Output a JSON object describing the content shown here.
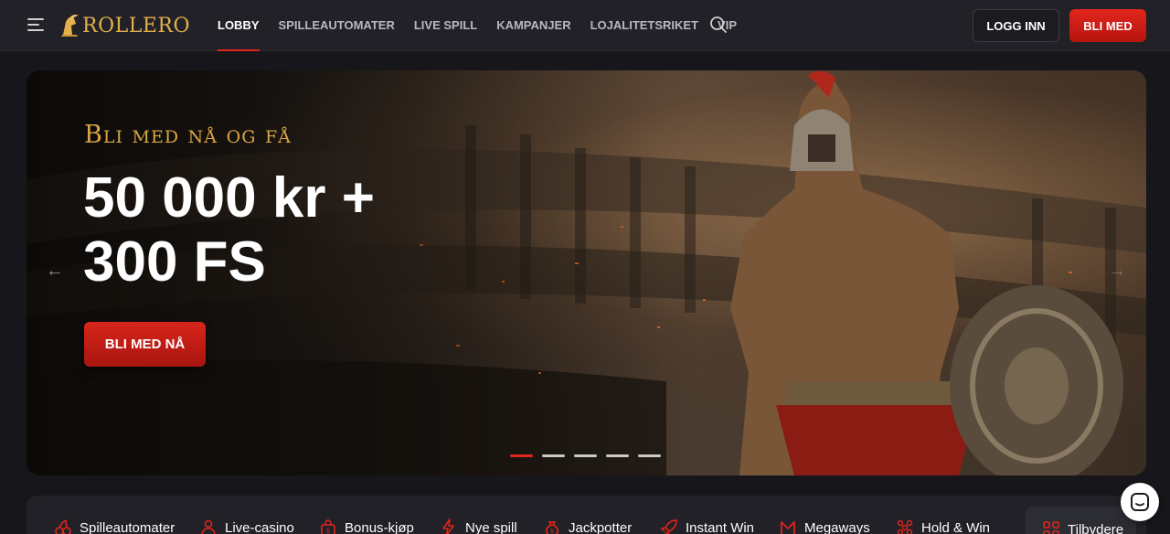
{
  "header": {
    "logo_text": "ROLLERO",
    "nav": [
      {
        "label": "LOBBY",
        "active": true
      },
      {
        "label": "SPILLEAUTOMATER",
        "active": false
      },
      {
        "label": "LIVE SPILL",
        "active": false
      },
      {
        "label": "KAMPANJER",
        "active": false
      },
      {
        "label": "LOJALITETSRIKET",
        "active": false
      },
      {
        "label": "VIP",
        "active": false
      }
    ],
    "login_label": "LOGG INN",
    "join_label": "BLI MED"
  },
  "hero": {
    "subtitle": "Bli med nå og få",
    "title_line1": "50 000 kr +",
    "title_line2": "300 FS",
    "cta_label": "BLI MED NÅ",
    "slides_total": 5,
    "active_slide": 1
  },
  "categories": [
    {
      "label": "Spilleautomater",
      "icon": "cherries-icon"
    },
    {
      "label": "Live-casino",
      "icon": "dealer-icon"
    },
    {
      "label": "Bonus-kjøp",
      "icon": "gift-bag-icon"
    },
    {
      "label": "Nye spill",
      "icon": "lightning-icon"
    },
    {
      "label": "Jackpotter",
      "icon": "money-bag-icon"
    },
    {
      "label": "Instant Win",
      "icon": "rocket-icon"
    },
    {
      "label": "Megaways",
      "icon": "megaways-icon"
    },
    {
      "label": "Hold & Win",
      "icon": "coins-grid-icon"
    },
    {
      "label": "Tilbydere",
      "icon": "grid-icon"
    }
  ],
  "colors": {
    "accent": "#e0251b",
    "gold": "#e3b04b",
    "header_bg": "#212127",
    "page_bg": "#17171b"
  }
}
